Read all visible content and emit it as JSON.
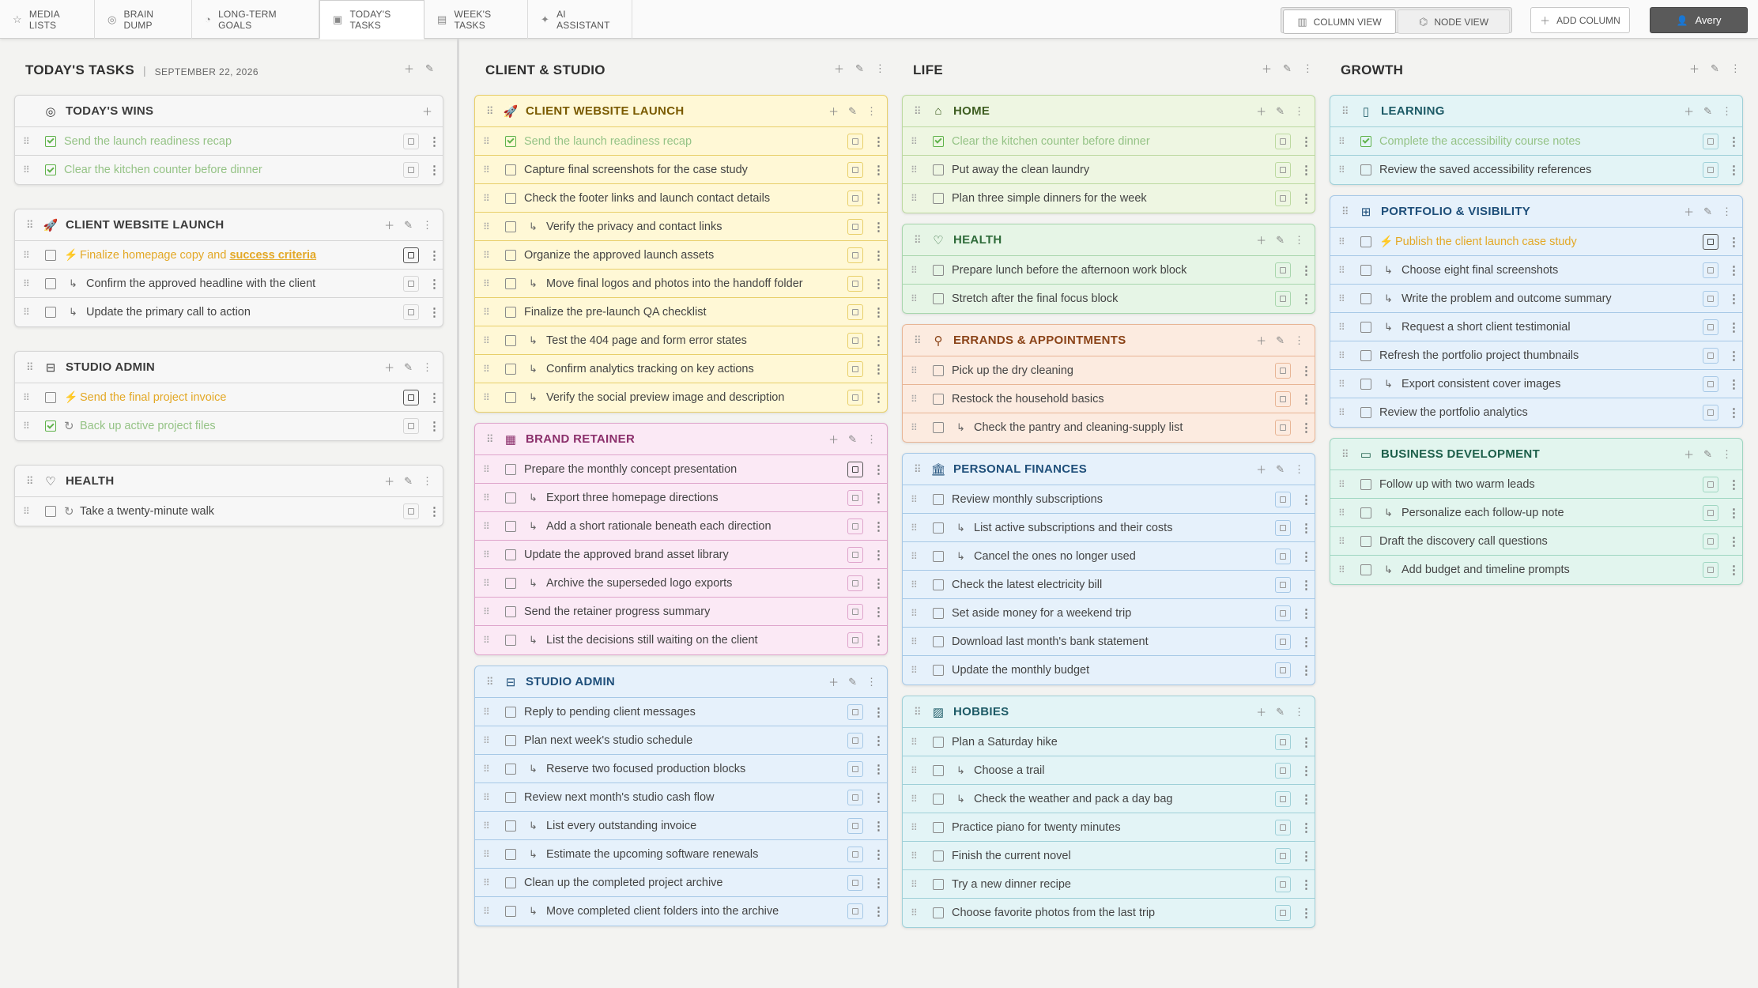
{
  "nav": {
    "tabs": [
      {
        "label": "MEDIA LISTS",
        "icon": "star-icon"
      },
      {
        "label": "BRAIN DUMP",
        "icon": "brain-icon"
      },
      {
        "label": "LONG-TERM GOALS",
        "icon": "target-icon"
      },
      {
        "label": "TODAY'S TASKS",
        "icon": "calendar-icon",
        "active": true
      },
      {
        "label": "WEEK'S TASKS",
        "icon": "calendar-week-icon"
      },
      {
        "label": "AI ASSISTANT",
        "icon": "ai-icon"
      }
    ],
    "column_view": "COLUMN VIEW",
    "node_view": "NODE VIEW",
    "add_column": "ADD COLUMN",
    "user": "Avery"
  },
  "columns": [
    {
      "title": "TODAY'S TASKS",
      "date": "SEPTEMBER 22, 2026",
      "cards": [
        {
          "title": "TODAY'S WINS",
          "icon": "target-icon",
          "color": "#3b3b3b",
          "bg": "#f7f7f7",
          "border": "#d5d5d5",
          "tasks": [
            {
              "text": "Send the launch readiness recap",
              "done": true
            },
            {
              "text": "Clear the kitchen counter before dinner",
              "done": true
            }
          ]
        },
        {
          "title": "CLIENT WEBSITE LAUNCH",
          "icon": "rocket-icon",
          "color": "#3b3b3b",
          "bg": "#f7f7f7",
          "border": "#d5d5d5",
          "tasks": [
            {
              "text": "Finalize homepage copy and ",
              "strong": "success criteria",
              "priority": true,
              "planned": true
            },
            {
              "text": "Confirm the approved headline with the client",
              "sub": true
            },
            {
              "text": "Update the primary call to action",
              "sub": true
            }
          ]
        },
        {
          "title": "STUDIO ADMIN",
          "icon": "inbox-icon",
          "color": "#3b3b3b",
          "bg": "#f7f7f7",
          "border": "#d5d5d5",
          "tasks": [
            {
              "text": "Send the final project invoice",
              "priority": true,
              "planned": true
            },
            {
              "text": "Back up active project files",
              "done": true,
              "recurring": true
            }
          ]
        },
        {
          "title": "HEALTH",
          "icon": "heart-icon",
          "color": "#3b3b3b",
          "bg": "#f7f7f7",
          "border": "#d5d5d5",
          "tasks": [
            {
              "text": "Take a twenty-minute walk",
              "recurring": true
            }
          ]
        }
      ]
    },
    {
      "title": "CLIENT & STUDIO",
      "cards": [
        {
          "title": "CLIENT WEBSITE LAUNCH",
          "icon": "rocket-icon",
          "color": "#7a5a00",
          "bg": "#fff8d6",
          "border": "#e8cf6a",
          "tasks": [
            {
              "text": "Send the launch readiness recap",
              "done": true
            },
            {
              "text": "Capture final screenshots for the case study"
            },
            {
              "text": "Check the footer links and launch contact details"
            },
            {
              "text": "Verify the privacy and contact links",
              "sub": true
            },
            {
              "text": "Organize the approved launch assets"
            },
            {
              "text": "Move final logos and photos into the handoff folder",
              "sub": true
            },
            {
              "text": "Finalize the pre-launch QA checklist"
            },
            {
              "text": "Test the 404 page and form error states",
              "sub": true
            },
            {
              "text": "Confirm analytics tracking on key actions",
              "sub": true
            },
            {
              "text": "Verify the social preview image and description",
              "sub": true
            }
          ]
        },
        {
          "title": "BRAND RETAINER",
          "icon": "palette-icon",
          "color": "#8b2f6b",
          "bg": "#fbe9f5",
          "border": "#dea4cb",
          "tasks": [
            {
              "text": "Prepare the monthly concept presentation",
              "planned": true
            },
            {
              "text": "Export three homepage directions",
              "sub": true
            },
            {
              "text": "Add a short rationale beneath each direction",
              "sub": true
            },
            {
              "text": "Update the approved brand asset library"
            },
            {
              "text": "Archive the superseded logo exports",
              "sub": true
            },
            {
              "text": "Send the retainer progress summary"
            },
            {
              "text": "List the decisions still waiting on the client",
              "sub": true
            }
          ]
        },
        {
          "title": "STUDIO ADMIN",
          "icon": "inbox-icon",
          "color": "#1f4f7a",
          "bg": "#e6f1fb",
          "border": "#a6c8e6",
          "tasks": [
            {
              "text": "Reply to pending client messages"
            },
            {
              "text": "Plan next week's studio schedule"
            },
            {
              "text": "Reserve two focused production blocks",
              "sub": true
            },
            {
              "text": "Review next month's studio cash flow"
            },
            {
              "text": "List every outstanding invoice",
              "sub": true
            },
            {
              "text": "Estimate the upcoming software renewals",
              "sub": true
            },
            {
              "text": "Clean up the completed project archive"
            },
            {
              "text": "Move completed client folders into the archive",
              "sub": true
            }
          ]
        }
      ]
    },
    {
      "title": "LIFE",
      "cards": [
        {
          "title": "HOME",
          "icon": "house-icon",
          "color": "#3f5e22",
          "bg": "#eef6e2",
          "border": "#bcd9a0",
          "tasks": [
            {
              "text": "Clear the kitchen counter before dinner",
              "done": true
            },
            {
              "text": "Put away the clean laundry"
            },
            {
              "text": "Plan three simple dinners for the week"
            }
          ]
        },
        {
          "title": "HEALTH",
          "icon": "heart-icon",
          "color": "#2f6b3a",
          "bg": "#e6f5e6",
          "border": "#a8d6ad",
          "tasks": [
            {
              "text": "Prepare lunch before the afternoon work block"
            },
            {
              "text": "Stretch after the final focus block"
            }
          ]
        },
        {
          "title": "ERRANDS & APPOINTMENTS",
          "icon": "pin-icon",
          "color": "#8a4318",
          "bg": "#fcebe0",
          "border": "#e8b595",
          "tasks": [
            {
              "text": "Pick up the dry cleaning"
            },
            {
              "text": "Restock the household basics"
            },
            {
              "text": "Check the pantry and cleaning-supply list",
              "sub": true
            }
          ]
        },
        {
          "title": "PERSONAL FINANCES",
          "icon": "bank-icon",
          "color": "#1f4f7a",
          "bg": "#e6f1fb",
          "border": "#a6c8e6",
          "tasks": [
            {
              "text": "Review monthly subscriptions"
            },
            {
              "text": "List active subscriptions and their costs",
              "sub": true
            },
            {
              "text": "Cancel the ones no longer used",
              "sub": true
            },
            {
              "text": "Check the latest electricity bill"
            },
            {
              "text": "Set aside money for a weekend trip"
            },
            {
              "text": "Download last month's bank statement"
            },
            {
              "text": "Update the monthly budget"
            }
          ]
        },
        {
          "title": "HOBBIES",
          "icon": "image-icon",
          "color": "#1d5a66",
          "bg": "#e3f4f6",
          "border": "#9fd0d8",
          "tasks": [
            {
              "text": "Plan a Saturday hike"
            },
            {
              "text": "Choose a trail",
              "sub": true
            },
            {
              "text": "Check the weather and pack a day bag",
              "sub": true
            },
            {
              "text": "Practice piano for twenty minutes"
            },
            {
              "text": "Finish the current novel"
            },
            {
              "text": "Try a new dinner recipe"
            },
            {
              "text": "Choose favorite photos from the last trip"
            }
          ]
        }
      ]
    },
    {
      "title": "GROWTH",
      "cards": [
        {
          "title": "LEARNING",
          "icon": "book-icon",
          "color": "#1d5a66",
          "bg": "#e3f4f6",
          "border": "#9fd0d8",
          "tasks": [
            {
              "text": "Complete the accessibility course notes",
              "done": true
            },
            {
              "text": "Review the saved accessibility references"
            }
          ]
        },
        {
          "title": "PORTFOLIO & VISIBILITY",
          "icon": "grid-icon",
          "color": "#1f4f7a",
          "bg": "#e6f1fb",
          "border": "#a6c8e6",
          "tasks": [
            {
              "text": "Publish the client launch case study",
              "priority": true,
              "planned": true
            },
            {
              "text": "Choose eight final screenshots",
              "sub": true
            },
            {
              "text": "Write the problem and outcome summary",
              "sub": true
            },
            {
              "text": "Request a short client testimonial",
              "sub": true
            },
            {
              "text": "Refresh the portfolio project thumbnails"
            },
            {
              "text": "Export consistent cover images",
              "sub": true
            },
            {
              "text": "Review the portfolio analytics"
            }
          ]
        },
        {
          "title": "BUSINESS DEVELOPMENT",
          "icon": "presentation-icon",
          "color": "#1d5f4a",
          "bg": "#e2f5ee",
          "border": "#9fd6c1",
          "tasks": [
            {
              "text": "Follow up with two warm leads"
            },
            {
              "text": "Personalize each follow-up note",
              "sub": true
            },
            {
              "text": "Draft the discovery call questions"
            },
            {
              "text": "Add budget and timeline prompts",
              "sub": true
            }
          ]
        }
      ]
    }
  ]
}
